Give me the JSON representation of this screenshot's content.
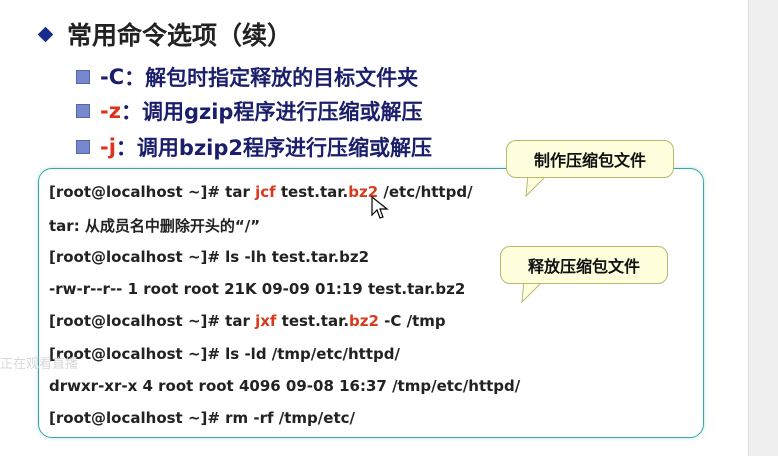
{
  "title": "常用命令选项（续）",
  "bullets": [
    {
      "opt": "-C",
      "sep": "：",
      "text": "解包时指定释放的目标文件夹"
    },
    {
      "opt": "-z",
      "sep": "：",
      "text": "调用gzip程序进行压缩或解压"
    },
    {
      "opt": "-j",
      "sep": "：",
      "text": "调用bzip2程序进行压缩或解压"
    }
  ],
  "terminal": {
    "line1": {
      "prompt": "[root@localhost ~]# tar ",
      "opt": "jcf",
      "mid": " test.tar.",
      "ext": "bz2",
      "rest": " /etc/httpd/"
    },
    "line2": "tar: 从成员名中删除开头的“/”",
    "line3": "[root@localhost ~]# ls -lh test.tar.bz2",
    "line4": "-rw-r--r-- 1 root root 21K 09-09 01:19 test.tar.bz2",
    "line5": {
      "prompt": "[root@localhost ~]# tar ",
      "opt": "jxf",
      "mid": " test.tar.",
      "ext": "bz2",
      "rest": " -C /tmp"
    },
    "line6": "[root@localhost ~]# ls -ld /tmp/etc/httpd/",
    "line7": "drwxr-xr-x 4 root root 4096 09-08 16:37 /tmp/etc/httpd/",
    "line8": "[root@localhost ~]# rm -rf /tmp/etc/"
  },
  "callouts": {
    "create": "制作压缩包文件",
    "extract": "释放压缩包文件"
  },
  "watermark": "正在观看直播",
  "colors": {
    "accent_red": "#d83a1e",
    "title_navy": "#1b1f6b",
    "terminal_border": "#3aa7a7",
    "callout_bg": "#ffffde"
  },
  "icons": [
    "diamond-bullet-icon",
    "square-bullet-icon",
    "mouse-cursor-icon"
  ]
}
